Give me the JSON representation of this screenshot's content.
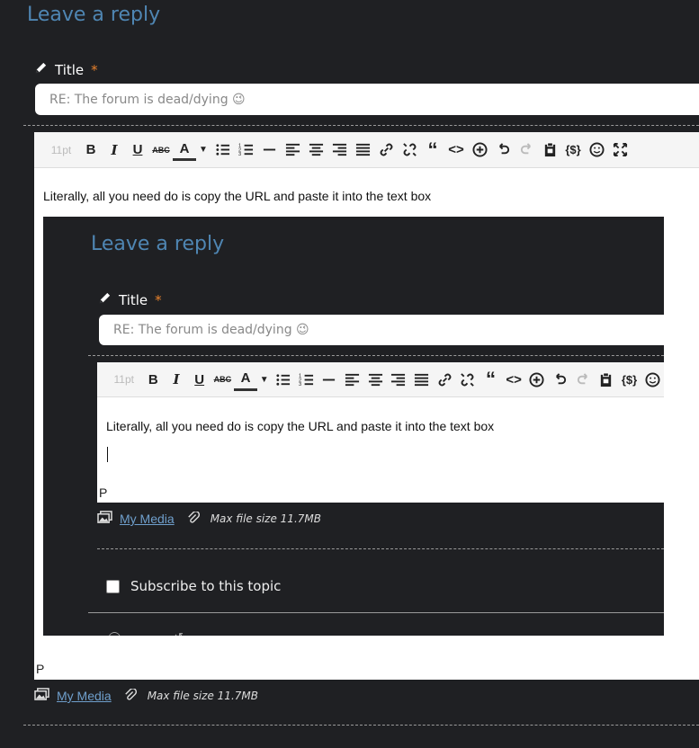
{
  "outer": {
    "heading": "Leave a reply",
    "title_label": "Title",
    "required_mark": "*",
    "title_value": "RE: The forum is dead/dying 😉",
    "font_size_label": "11pt",
    "body_text": "Literally, all you need do is copy the URL and paste it into the text box",
    "path_label": "P",
    "my_media": "My Media",
    "max_file_size": "Max file size 11.7MB"
  },
  "inner": {
    "heading": "Leave a reply",
    "title_label": "Title",
    "required_mark": "*",
    "title_value": "RE: The forum is dead/dying 😉",
    "font_size_label": "11pt",
    "body_text": "Literally, all you need do is copy the URL and paste it into the text box",
    "path_label": "P",
    "my_media": "My Media",
    "max_file_size": "Max file size 11.7MB",
    "subscribe_label": "Subscribe to this topic",
    "subscribed": false
  },
  "toolbar_icons": [
    "font-size",
    "bold",
    "italic",
    "underline",
    "strikethrough",
    "text-color",
    "color-dropdown",
    "bullet-list",
    "numbered-list",
    "horizontal-rule",
    "align-left",
    "align-center",
    "align-right",
    "justify",
    "link",
    "unlink",
    "blockquote",
    "code",
    "insert",
    "undo",
    "redo",
    "paste",
    "shortcode",
    "emoji",
    "fullscreen"
  ],
  "colors": {
    "background": "#1f2023",
    "heading": "#4f86b3",
    "required": "#e8812c",
    "link": "#6f9fcc"
  }
}
